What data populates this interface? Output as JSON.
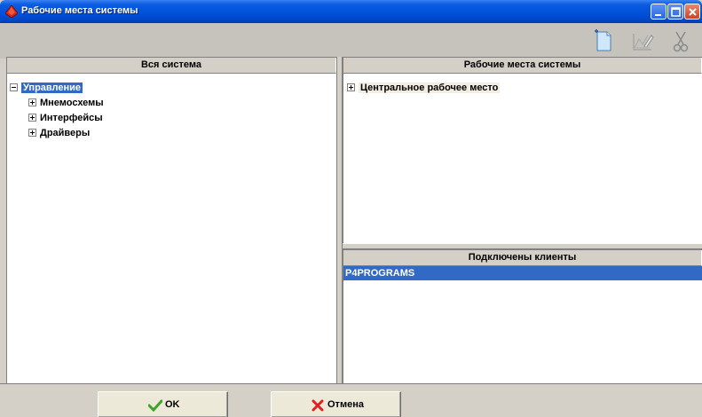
{
  "window": {
    "title": "Рабочие места системы",
    "icon": "red-diamond-icon",
    "controls": [
      "minimize-icon",
      "maximize-icon",
      "close-icon"
    ]
  },
  "toolbar": {
    "tools": [
      "new-document-icon",
      "edit-icon",
      "cut-icon"
    ]
  },
  "left_panel": {
    "header": "Вся система",
    "tree": {
      "root": {
        "label": "Управление",
        "expanded": true,
        "selected": true
      },
      "children": [
        {
          "label": "Мнемосхемы",
          "expanded": false
        },
        {
          "label": "Интерфейсы",
          "expanded": false
        },
        {
          "label": "Драйверы",
          "expanded": false
        }
      ]
    }
  },
  "workplaces_panel": {
    "header": "Рабочие места системы",
    "items": [
      {
        "label": "Центральное рабочее место",
        "expanded": false
      }
    ]
  },
  "clients_panel": {
    "header": "Подключены клиенты",
    "items": [
      {
        "label": "P4PROGRAMS",
        "selected": true
      }
    ]
  },
  "buttons": {
    "ok_label": "OK",
    "cancel_label": "Отмена"
  },
  "colors": {
    "title_bar": "#0050d8",
    "selection": "#316ac5",
    "ok_check": "#3aa52a",
    "cancel_x": "#e02020"
  }
}
